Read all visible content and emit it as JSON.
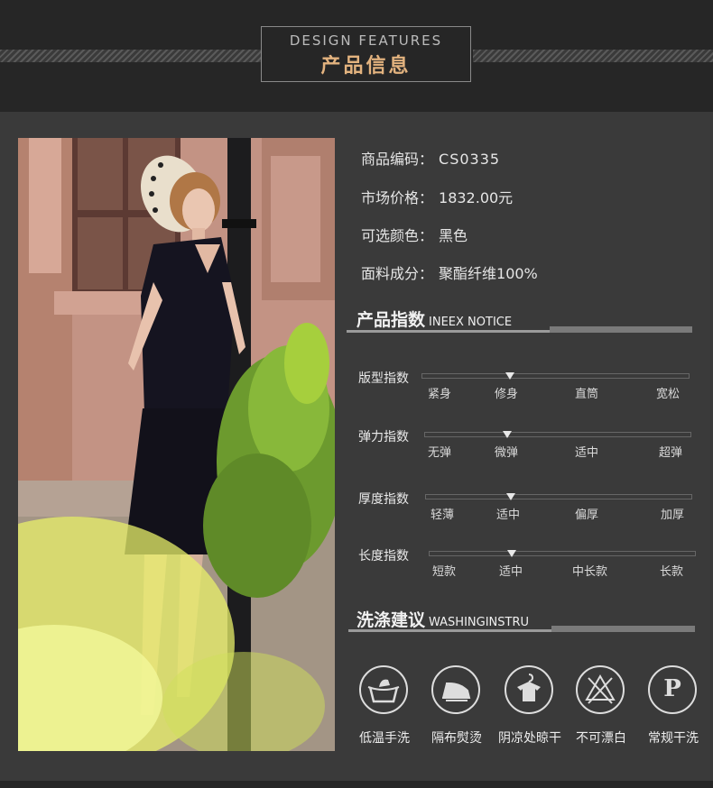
{
  "header": {
    "title_en": "DESIGN FEATURES",
    "title_cn": "产品信息"
  },
  "info": [
    {
      "label": "商品编码：",
      "value": "CS0335"
    },
    {
      "label": "市场价格：",
      "value": "1832.00元"
    },
    {
      "label": "可选颜色：",
      "value": "黑色"
    },
    {
      "label": "面料成分：",
      "value": "聚酯纤维100%"
    }
  ],
  "index_section": {
    "title": "产品指数",
    "subtitle": "INEEX NOTICE"
  },
  "indices": [
    {
      "label": "版型指数",
      "ticks": [
        "紧身",
        "修身",
        "直筒",
        "宽松"
      ],
      "level": 0.33
    },
    {
      "label": "弹力指数",
      "ticks": [
        "无弹",
        "微弹",
        "适中",
        "超弹"
      ],
      "level": 0.31
    },
    {
      "label": "厚度指数",
      "ticks": [
        "轻薄",
        "适中",
        "偏厚",
        "加厚"
      ],
      "level": 0.32
    },
    {
      "label": "长度指数",
      "ticks": [
        "短款",
        "适中",
        "中长款",
        "长款"
      ],
      "level": 0.31
    }
  ],
  "wash_section": {
    "title": "洗涤建议",
    "subtitle": "WASHINGINSTRU"
  },
  "wash": [
    {
      "icon": "hand-wash-icon",
      "label": "低温手洗"
    },
    {
      "icon": "iron-icon",
      "label": "隔布熨烫"
    },
    {
      "icon": "hanger-dry-icon",
      "label": "阴凉处晾干"
    },
    {
      "icon": "no-bleach-icon",
      "label": "不可漂白"
    },
    {
      "icon": "dry-clean-icon",
      "label": "常规干洗",
      "glyph": "P"
    }
  ],
  "colors": {
    "accent": "#e3b37f",
    "background": "#3a3a3a"
  }
}
